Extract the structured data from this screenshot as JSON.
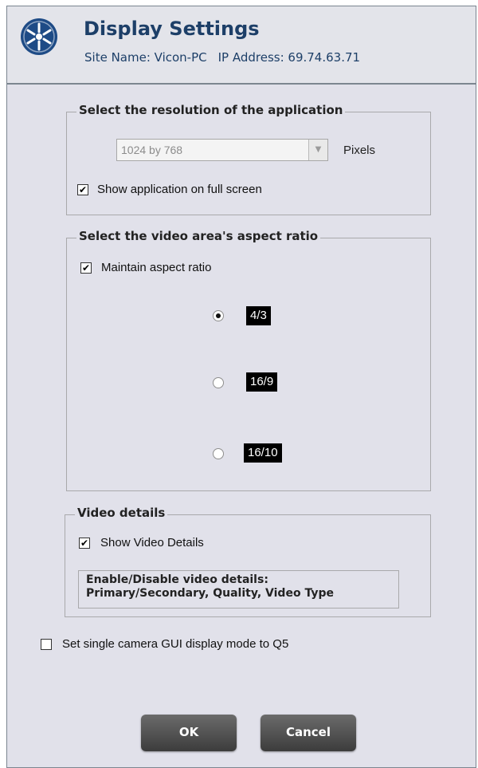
{
  "header": {
    "title": "Display Settings",
    "site_label": "Site Name: Vicon-PC",
    "ip_label": "IP Address: 69.74.63.71",
    "logo_icon": "compass-star-icon"
  },
  "resolution": {
    "legend": "Select the resolution of the application",
    "selected": "1024 by 768",
    "unit": "Pixels",
    "fullscreen_label": "Show application on full screen",
    "fullscreen_checked": true,
    "combo_enabled": false
  },
  "aspect": {
    "legend": "Select the video area's aspect ratio",
    "maintain_label": "Maintain aspect ratio",
    "maintain_checked": true,
    "options": [
      {
        "label": "4/3",
        "selected": true
      },
      {
        "label": "16/9",
        "selected": false
      },
      {
        "label": "16/10",
        "selected": false
      }
    ]
  },
  "video": {
    "legend": "Video details",
    "show_label": "Show Video Details",
    "show_checked": true,
    "description_line1": "Enable/Disable video details:",
    "description_line2": "Primary/Secondary, Quality, Video Type"
  },
  "single_camera": {
    "label": "Set single camera GUI display mode to Q5",
    "checked": false
  },
  "buttons": {
    "ok": "OK",
    "cancel": "Cancel"
  },
  "colors": {
    "title": "#1d3f68",
    "logo_fill": "#1e4b86",
    "background": "#e1e1ea"
  }
}
